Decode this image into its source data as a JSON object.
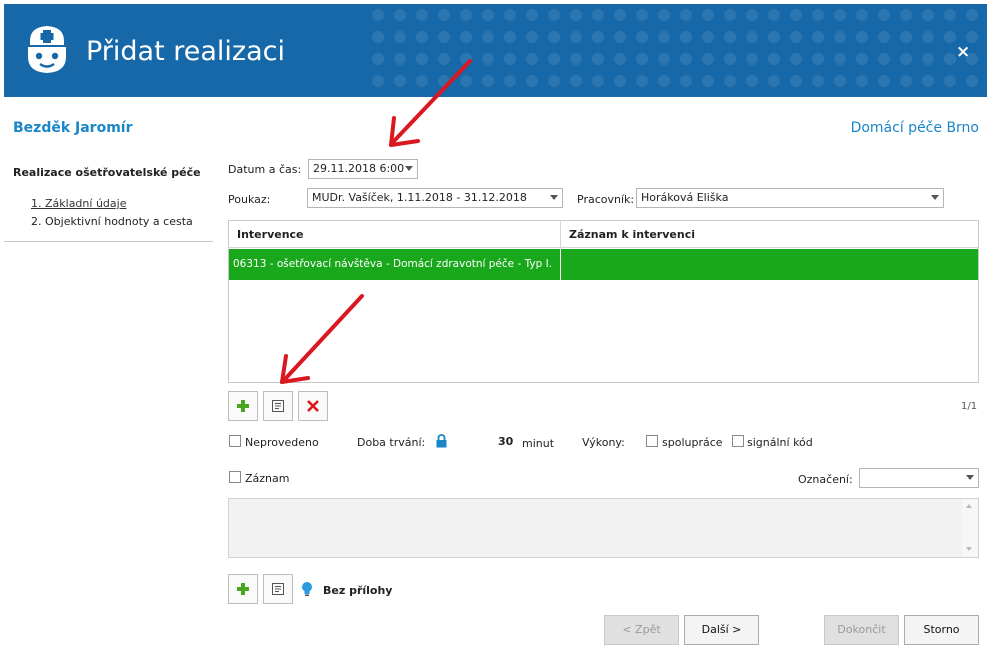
{
  "window": {
    "title": "Přidat realizaci",
    "close_label": "×"
  },
  "patient_name": "Bezděk Jaromír",
  "organization": "Domácí péče Brno",
  "sidebar": {
    "heading": "Realizace ošetřovatelské péče",
    "steps": [
      {
        "label": "1. Základní údaje"
      },
      {
        "label": "2. Objektivní hodnoty a cesta"
      }
    ]
  },
  "form": {
    "datetime_label": "Datum a čas:",
    "datetime_value": "29.11.2018 6:00",
    "voucher_label": "Poukaz:",
    "voucher_value": "MUDr. Vašíček, 1.11.2018 - 31.12.2018",
    "worker_label": "Pracovník:",
    "worker_value": "Horáková Eliška"
  },
  "grid": {
    "columns": [
      "Intervence",
      "Záznam k intervenci"
    ],
    "rows": [
      {
        "intervention": "06313 - ošetřovací návštěva - Domácí zdravotní péče - Typ I.",
        "record": ""
      }
    ],
    "pager": "1/1",
    "row_highlight_color": "#19a81b"
  },
  "options": {
    "not_performed_label": "Neprovedeno",
    "duration_label": "Doba trvání:",
    "duration_value": "30",
    "duration_unit": "minut",
    "performances_label": "Výkony:",
    "cooperation_label": "spolupráce",
    "signal_code_label": "signální kód",
    "record_label": "Záznam",
    "marking_label": "Označení:",
    "marking_value": ""
  },
  "attachments": {
    "label": "Bez přílohy"
  },
  "footer": {
    "back_label": "< Zpět",
    "next_label": "Další >",
    "finish_label": "Dokončit",
    "cancel_label": "Storno"
  },
  "colors": {
    "header_blue": "#1668a8",
    "accent_blue": "#1a86c8",
    "annotation_red": "#d9181f"
  },
  "icons": [
    "nurse-logo-icon",
    "close-icon",
    "add-icon",
    "edit-note-icon",
    "delete-icon",
    "lock-icon",
    "lightbulb-icon",
    "dropdown-arrow-icon"
  ]
}
